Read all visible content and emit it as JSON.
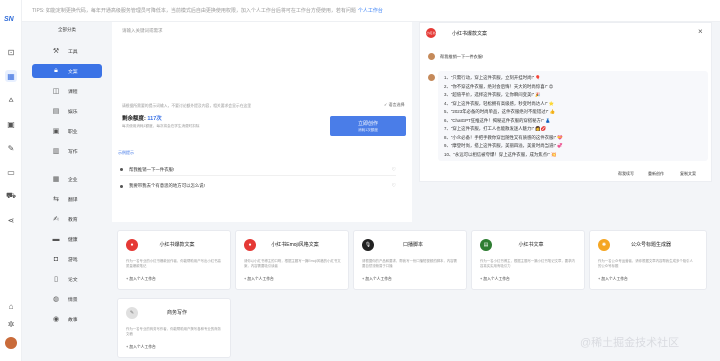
{
  "rail": {
    "logo": "SN",
    "icons": [
      "bot-icon",
      "grid-icon",
      "chart-icon",
      "gallery-icon",
      "edit-icon",
      "subscribe-icon",
      "cart-icon",
      "share-icon"
    ],
    "bottom": [
      "gift-icon",
      "settings-icon",
      "avatar"
    ]
  },
  "topbar": {
    "text": "TIPS: 如能定制更换代码，每年开通高级服务管理员可降低本，当前模式后自由更换使用权限，加入个人工作台后将可在工作台方便使用，若有问题",
    "link": "个人工作台"
  },
  "categories": {
    "head": "全部分类",
    "items": [
      {
        "label": "工具",
        "icon": "toolbox-icon"
      },
      {
        "label": "文案",
        "icon": "copy-icon",
        "active": true
      },
      {
        "label": "课程",
        "icon": "course-icon"
      },
      {
        "label": "娱乐",
        "icon": "entertainment-icon"
      },
      {
        "label": "职业",
        "icon": "career-icon"
      },
      {
        "label": "写作",
        "icon": "writing-icon"
      },
      {
        "label": "企业",
        "icon": "company-icon"
      },
      {
        "label": "翻译",
        "icon": "translate-icon"
      },
      {
        "label": "教育",
        "icon": "education-icon"
      },
      {
        "label": "健康",
        "icon": "health-icon"
      },
      {
        "label": "游戏",
        "icon": "game-icon"
      },
      {
        "label": "论文",
        "icon": "paper-icon"
      },
      {
        "label": "情景",
        "icon": "scene-icon"
      },
      {
        "label": "故事",
        "icon": "story-icon"
      }
    ]
  },
  "input": {
    "placeholder": "请输入关键词或需求",
    "note": "请根据所需要的提示词输入，不要讨论额外提及内容，相关要求会显示在这里",
    "lang": "✓ 语言选择",
    "quota_label": "剩余额度:",
    "quota_value": "117次",
    "quota_sub": "每次使用消耗1额度，每次将会在学生消费时扣除",
    "gen_label": "立即创作",
    "gen_sub": "消耗1次额度",
    "examples_title": "示例提示",
    "examples": [
      "帮我推销一下一件衣服!",
      "我要带我去个有意思的地方可以怎么说!"
    ]
  },
  "output": {
    "badge": "小红书",
    "title": "小红书爆款文案",
    "question": "帮我推销一下一件衣服!",
    "lines": [
      "1、\"只需行动，穿上这件衣服，立刻开挂时尚!\" 🎈",
      "2、\"你不穿这件衣服，绝对会后悔！天大的时尚惊喜!\" 😍",
      "3、\"超值平价，选择这件衣服，让你瞬间变美!\" 🎉",
      "4、\"穿上这件衣服，轻松拥有高级感，秒变时尚达人!\" ⭐",
      "5、\"2023年必备的时尚单品，这件衣服绝对不能错过!\" 👍",
      "6、\"ChatGPT狂推这件！揭秘这件衣服的穿搭秘方!\" 👗",
      "7、\"穿上这件衣服，打工人也能散发迷人魅力!\" 👩💋",
      "8、\"小众必备！手把手教你穿出随性又有质感的这件衣服!\" 💝",
      "9、\"摩登时尚，搭上这件衣服，美丽四溢，美爱时尚当道!\" 💞",
      "10、\"永远可以相信被夸爆！穿上这件衣服，成为焦点!\" 💥"
    ],
    "btn_continue": "帮我续写",
    "btn_regen": "重新创作",
    "btn_copy": "复制文案"
  },
  "cards": [
    {
      "title": "小红书爆款文案",
      "icon": "xiaohongshu-icon",
      "color": "#e53935",
      "desc": "作为一名专业的小红书爆款创作者，你能帮助用户写出小红书高质量爆款笔记",
      "add": "+ 加入个人工作台"
    },
    {
      "title": "小红书Emoji风格文案",
      "icon": "xiaohongshu-icon",
      "color": "#e53935",
      "desc": "请你以小红书博主的口吻，根据主题写一篇Emoji风格的小红书文案，内容需要吸引读者",
      "add": "+ 加入个人工作台"
    },
    {
      "title": "口播脚本",
      "icon": "microphone-icon",
      "color": "#222222",
      "desc": "请根据你的产品和要求，帮我写一份口播短视频的脚本，内容需要自然流畅易于口播",
      "add": "+ 加入个人工作台"
    },
    {
      "title": "小红书文章",
      "icon": "document-icon",
      "color": "#2e7d32",
      "desc": "作为一名小红书博主，根据主题写一篇小红书笔记文章，要求内容真实实用有吸引力",
      "add": "+ 加入个人工作台"
    },
    {
      "title": "公众号标题生成器",
      "icon": "light-icon",
      "color": "#f5a623",
      "desc": "作为一名公众号运营者，请你根据文章内容帮我生成多个吸引人的公众号标题",
      "add": "+ 加入个人工作台"
    },
    {
      "title": "商务写作",
      "icon": "pen-icon",
      "color": "#e0e0e0",
      "desc": "作为一名专业的商务写作者，你能帮助用户撰写各种专业的商务文稿",
      "add": "+ 加入个人工作台"
    }
  ],
  "watermark": "@稀土掘金技术社区"
}
